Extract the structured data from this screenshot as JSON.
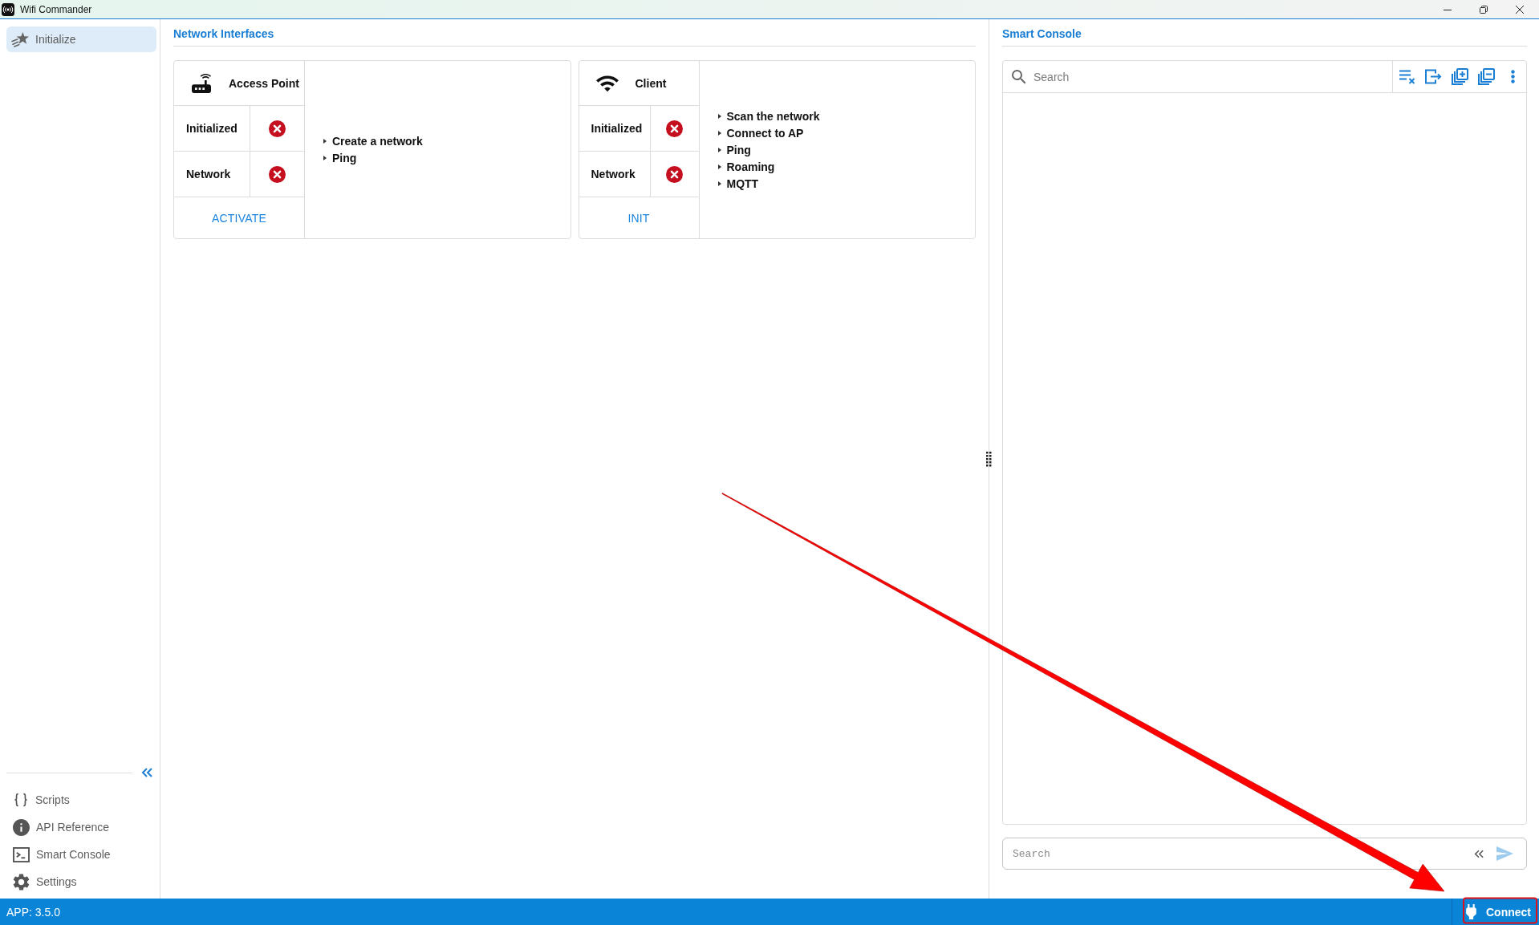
{
  "window": {
    "title": "Wifi Commander"
  },
  "sidebar": {
    "items": [
      {
        "label": "Initialize",
        "selected": true
      }
    ],
    "footer_items": [
      {
        "label": "Scripts",
        "selected": false
      },
      {
        "label": "API Reference",
        "selected": false
      },
      {
        "label": "Smart Console",
        "selected": false
      },
      {
        "label": "Settings",
        "selected": false
      }
    ]
  },
  "network_interfaces": {
    "title": "Network Interfaces",
    "cards": [
      {
        "title": "Access Point",
        "rows": [
          {
            "label": "Initialized",
            "ok": false
          },
          {
            "label": "Network",
            "ok": false
          }
        ],
        "button": "ACTIVATE",
        "actions": [
          "Create a network",
          "Ping"
        ]
      },
      {
        "title": "Client",
        "rows": [
          {
            "label": "Initialized",
            "ok": false
          },
          {
            "label": "Network",
            "ok": false
          }
        ],
        "button": "INIT",
        "actions": [
          "Scan the network",
          "Connect to AP",
          "Ping",
          "Roaming",
          "MQTT"
        ]
      }
    ]
  },
  "smart_console": {
    "title": "Smart Console",
    "search": {
      "placeholder": "Search"
    },
    "command_input": {
      "placeholder": "Search"
    }
  },
  "status_bar": {
    "version": "APP: 3.5.0",
    "connect_button": "Connect"
  },
  "annotations": {
    "arrow": true,
    "highlight_frame": true
  }
}
